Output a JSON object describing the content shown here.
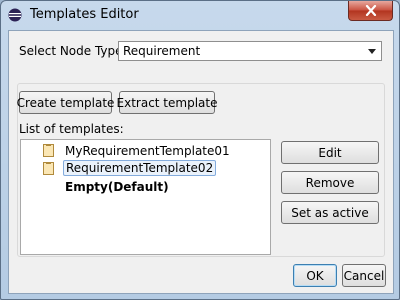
{
  "window": {
    "title": "Templates Editor",
    "icon": "eclipse-icon"
  },
  "node_type": {
    "label": "Select Node Type",
    "selected": "Requirement"
  },
  "toolbar": {
    "create_label": "Create template",
    "extract_label": "Extract template"
  },
  "templates": {
    "header": "List of templates:",
    "items": [
      {
        "label": "MyRequirementTemplate01",
        "icon": "document-icon",
        "selected": false,
        "bold": false
      },
      {
        "label": "RequirementTemplate02",
        "icon": "document-icon",
        "selected": true,
        "bold": false
      },
      {
        "label": "Empty(Default)",
        "icon": "",
        "selected": false,
        "bold": true
      }
    ]
  },
  "actions": {
    "edit_label": "Edit",
    "remove_label": "Remove",
    "set_active_label": "Set as active"
  },
  "dialog": {
    "ok_label": "OK",
    "cancel_label": "Cancel"
  },
  "colors": {
    "selection_border": "#84acdd",
    "selection_fill": "#eaf2fb",
    "close_button": "#c9503e"
  }
}
